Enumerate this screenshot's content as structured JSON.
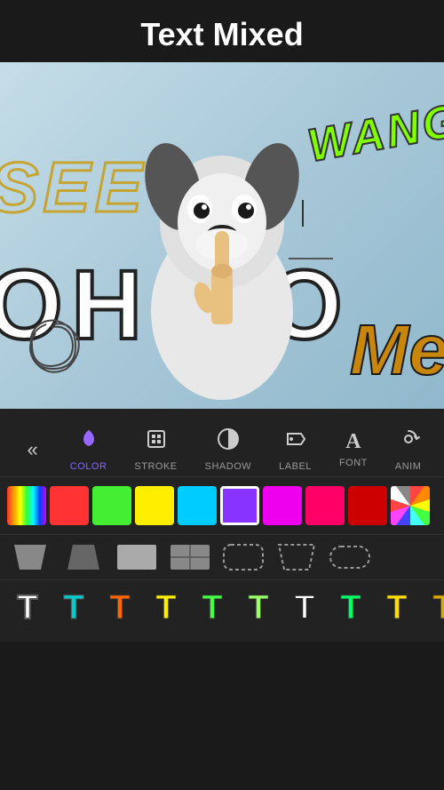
{
  "header": {
    "title": "Text Mixed"
  },
  "canvas": {
    "texts": {
      "see": "SEE",
      "wang": "WANG",
      "oh_no": "OH  NO",
      "me": "Me"
    }
  },
  "toolbar": {
    "back_label": "«",
    "tools": [
      {
        "id": "color",
        "label": "COLOR",
        "icon": "💧",
        "active": true
      },
      {
        "id": "stroke",
        "label": "STROKE",
        "icon": "⊞",
        "active": false
      },
      {
        "id": "shadow",
        "label": "SHADOW",
        "icon": "◑",
        "active": false
      },
      {
        "id": "label",
        "label": "LABEL",
        "icon": "▶",
        "active": false
      },
      {
        "id": "font",
        "label": "FONT",
        "icon": "A",
        "active": false
      },
      {
        "id": "anim",
        "label": "ANIM",
        "icon": "↻",
        "active": false
      }
    ]
  },
  "colors": [
    {
      "id": "gradient",
      "type": "gradient",
      "label": "gradient swatch"
    },
    {
      "id": "red",
      "color": "#ff3333",
      "label": "red"
    },
    {
      "id": "green",
      "color": "#44ee33",
      "label": "green"
    },
    {
      "id": "yellow",
      "color": "#ffee00",
      "label": "yellow"
    },
    {
      "id": "cyan",
      "color": "#00ddff",
      "label": "cyan"
    },
    {
      "id": "purple",
      "color": "#9933ff",
      "label": "purple",
      "selected": true
    },
    {
      "id": "magenta",
      "color": "#ee00ee",
      "label": "magenta"
    },
    {
      "id": "hotpink",
      "color": "#ff0066",
      "label": "hot pink"
    },
    {
      "id": "darkred",
      "color": "#cc0000",
      "label": "dark red"
    },
    {
      "id": "multi",
      "type": "multi",
      "label": "multi color"
    }
  ],
  "shapes": [
    {
      "id": "parallelogram",
      "label": "parallelogram"
    },
    {
      "id": "trapezoid",
      "label": "trapezoid"
    },
    {
      "id": "rectangle",
      "label": "rectangle"
    },
    {
      "id": "grid-rect",
      "label": "grid rectangle"
    },
    {
      "id": "rounded-dashed",
      "label": "rounded dashed"
    },
    {
      "id": "parallelogram-dashed",
      "label": "parallelogram dashed"
    },
    {
      "id": "stadium",
      "label": "stadium"
    }
  ],
  "text_styles": [
    {
      "id": "plain",
      "color": "#ffffff",
      "stroke": "none",
      "label": "plain white T"
    },
    {
      "id": "teal",
      "color": "#00cccc",
      "stroke": "none",
      "label": "teal T"
    },
    {
      "id": "orange",
      "color": "#ff6600",
      "stroke": "none",
      "label": "orange T"
    },
    {
      "id": "yellow",
      "color": "#ffee00",
      "stroke": "none",
      "label": "yellow T"
    },
    {
      "id": "green",
      "color": "#44ff44",
      "stroke": "none",
      "label": "green T"
    },
    {
      "id": "light-green",
      "color": "#99ff66",
      "stroke": "none",
      "label": "light green T"
    },
    {
      "id": "white-stroke",
      "color": "#ffffff",
      "stroke": "#333",
      "label": "white stroke T"
    },
    {
      "id": "green2",
      "color": "#00ff66",
      "stroke": "none",
      "label": "green2 T"
    },
    {
      "id": "yellow2",
      "color": "#ffdd00",
      "stroke": "none",
      "label": "yellow2 T"
    },
    {
      "id": "gold",
      "color": "#ddaa00",
      "stroke": "none",
      "label": "gold T"
    }
  ]
}
